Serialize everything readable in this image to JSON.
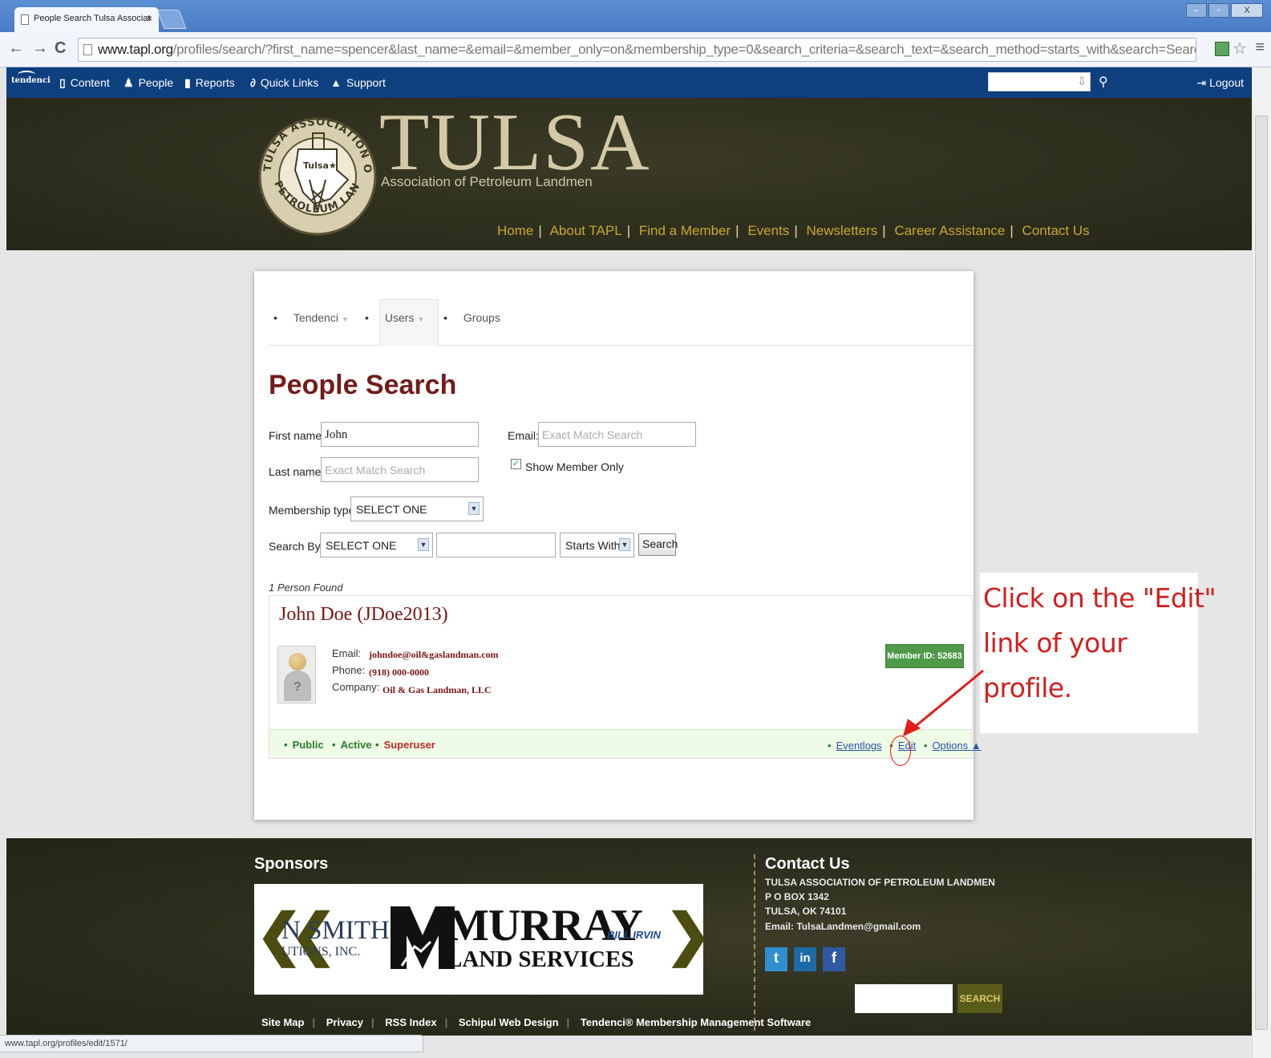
{
  "browser": {
    "tab_title": "People Search Tulsa Associat",
    "tab_close": "×",
    "url_host": "www.tapl.org",
    "url_path": "/profiles/search/?first_name=spencer&last_name=&email=&member_only=on&membership_type=0&search_criteria=&search_text=&search_method=starts_with&search=Search",
    "status_url": "www.tapl.org/profiles/edit/1571/",
    "win_controls": [
      "–",
      "▫",
      "X"
    ]
  },
  "adminbar": {
    "logo": "tendenci",
    "items": [
      {
        "icon": "▯",
        "label": "Content"
      },
      {
        "icon": "♟",
        "label": "People"
      },
      {
        "icon": "▮",
        "label": "Reports"
      },
      {
        "icon": "∂",
        "label": "Quick Links"
      },
      {
        "icon": "▲",
        "label": "Support"
      }
    ],
    "logout": "Logout"
  },
  "header": {
    "title": "TULSA",
    "subtitle": "Association of Petroleum Landmen",
    "seal_text_top": "TULSA ASSOCIATION OF",
    "seal_text_bottom": "PETROLEUM LANDMEN",
    "seal_center": "Tulsa★",
    "nav": [
      "Home",
      "About TAPL",
      "Find a Member",
      "Events",
      "Newsletters",
      "Career Assistance",
      "Contact Us"
    ]
  },
  "subnav": {
    "items": [
      "Tendenci",
      "Users",
      "Groups"
    ]
  },
  "search": {
    "title": "People Search",
    "first_name_label": "First name:",
    "first_name_value": "John",
    "email_label": "Email:",
    "email_placeholder": "Exact Match Search",
    "last_name_label": "Last name:",
    "last_name_placeholder": "Exact Match Search",
    "show_member_only": "Show Member Only",
    "membership_type_label": "Membership type:",
    "membership_type_value": "SELECT ONE",
    "search_by_label": "Search By:",
    "search_by_value": "SELECT ONE",
    "method_value": "Starts With",
    "search_button": "Search"
  },
  "results": {
    "found": "1 Person Found",
    "name": "John Doe (JDoe2013)",
    "email_label": "Email:",
    "email": "johndoe@oil&gaslandman.com",
    "phone_label": "Phone:",
    "phone": "(918) 000-0000",
    "company_label": "Company:",
    "company": "Oil & Gas Landman, LLC",
    "member_id": "Member ID: 52683",
    "avatar_glyph": "?",
    "status": [
      "Public",
      "Active",
      "Superuser"
    ],
    "actions": [
      "Eventlogs",
      "Edit",
      "Options ▲"
    ],
    "status_colors": {
      "public": "#2c7b2c",
      "active": "#2c7b2c",
      "superuser": "#c0282d"
    }
  },
  "annotation": {
    "lines": [
      "Click on the \"Edit\"",
      "link of your",
      "profile."
    ],
    "color": "#d21e1e"
  },
  "footer": {
    "sponsors_title": "Sponsors",
    "sponsor_1a": "N SMITH",
    "sponsor_1b": "UTIONS, INC.",
    "sponsor_2a": "MURRAY",
    "sponsor_2b": "LAND SERVICES",
    "sponsor_3": "BILL IRVIN",
    "contact_title": "Contact Us",
    "contact_lines": [
      "TULSA ASSOCIATION OF PETROLEUM LANDMEN",
      "P O BOX 1342",
      "TULSA, OK 74101",
      "Email: TulsaLandmen@gmail.com"
    ],
    "social": [
      "t",
      "in",
      "f"
    ],
    "search_button": "SEARCH",
    "links": [
      "Site Map",
      "Privacy",
      "RSS Index",
      "Schipul Web Design",
      "Tendenci® Membership Management Software"
    ]
  },
  "colors": {
    "admin_bar": "#0e3f7f",
    "header_bg": "#2e2e1e",
    "brand_gold": "#c8a82e",
    "title_maroon": "#731b1b",
    "member_badge": "#4f9a49"
  }
}
